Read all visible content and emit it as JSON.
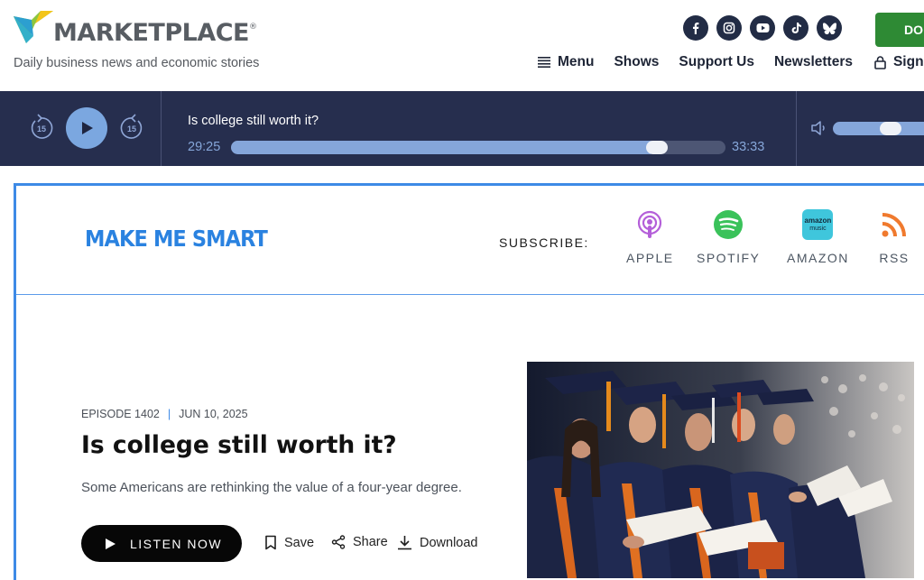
{
  "header": {
    "brand": "MARKETPLACE",
    "brand_mark": "®",
    "tagline": "Daily business news and economic stories",
    "social": [
      {
        "icon": "facebook-icon"
      },
      {
        "icon": "instagram-icon"
      },
      {
        "icon": "youtube-icon"
      },
      {
        "icon": "tiktok-icon"
      },
      {
        "icon": "bluesky-icon"
      }
    ],
    "donate_label": "DO",
    "nav": {
      "menu": "Menu",
      "shows": "Shows",
      "support": "Support Us",
      "newsletters": "Newsletters",
      "signin": "Sign"
    }
  },
  "player": {
    "title": "Is college still worth it?",
    "elapsed": "29:25",
    "total": "33:33",
    "progress": 0.877,
    "volume": 0.6,
    "skip_seconds": "15"
  },
  "show": {
    "name": "MAKE ME SMART",
    "subscribe_label": "SUBSCRIBE:",
    "subscribe": {
      "apple": "APPLE",
      "spotify": "SPOTIFY",
      "amazon": "AMAZON",
      "rss": "RSS"
    },
    "amazon_badge_line1": "amazon",
    "amazon_badge_line2": "music"
  },
  "episode": {
    "number": "EPISODE 1402",
    "date": "JUN 10, 2025",
    "title": "Is college still worth it?",
    "dek": "Some Americans are rethinking the value of a four-year degree.",
    "listen_label": "LISTEN NOW",
    "save_label": "Save",
    "share_label": "Share",
    "download_label": "Download"
  },
  "colors": {
    "player_bg": "#262e4e",
    "accent_blue": "#3d8ae6",
    "donate_green": "#2e8a34"
  }
}
